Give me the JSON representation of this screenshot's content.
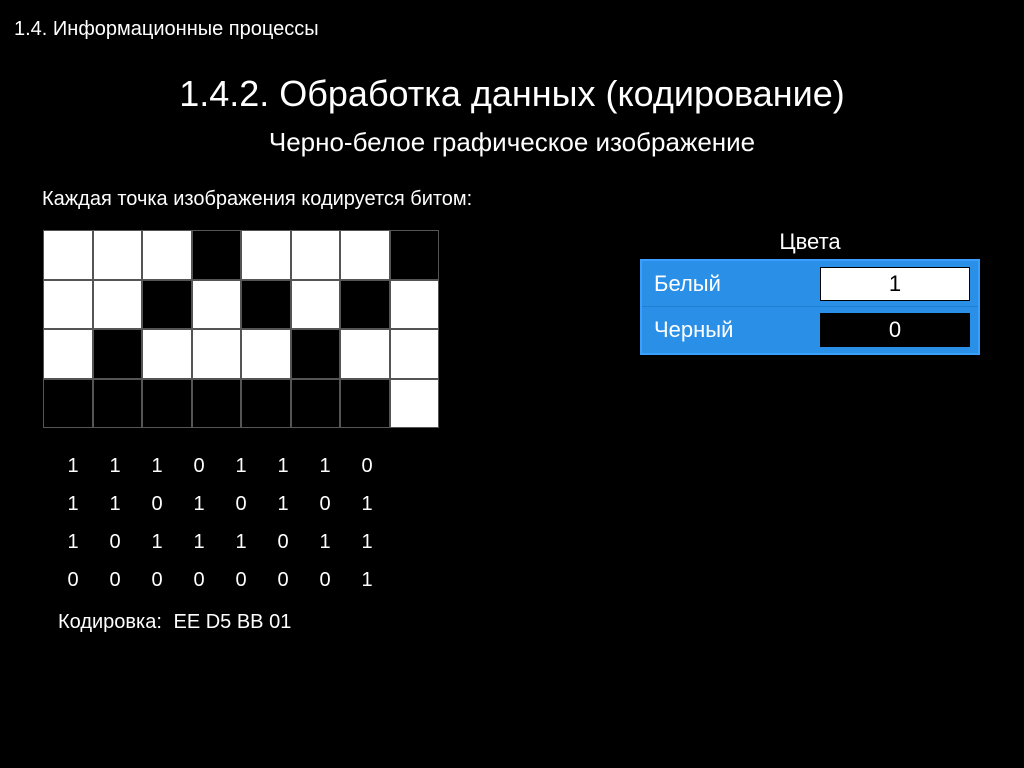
{
  "breadcrumb": "1.4. Информационные процессы",
  "title": "1.4.2. Обработка данных (кодирование)",
  "subtitle": "Черно-белое графическое изображение",
  "body_text": "Каждая точка изображения кодируется битом:",
  "pixel_grid": [
    [
      1,
      1,
      1,
      0,
      1,
      1,
      1,
      0
    ],
    [
      1,
      1,
      0,
      1,
      0,
      1,
      0,
      1
    ],
    [
      1,
      0,
      1,
      1,
      1,
      0,
      1,
      1
    ],
    [
      0,
      0,
      0,
      0,
      0,
      0,
      0,
      1
    ]
  ],
  "bit_rows": [
    [
      "1",
      "1",
      "1",
      "0",
      "1",
      "1",
      "1",
      "0"
    ],
    [
      "1",
      "1",
      "0",
      "1",
      "0",
      "1",
      "0",
      "1"
    ],
    [
      "1",
      "0",
      "1",
      "1",
      "1",
      "0",
      "1",
      "1"
    ],
    [
      "0",
      "0",
      "0",
      "0",
      "0",
      "0",
      "0",
      "1"
    ]
  ],
  "encoding_label": "Кодировка:",
  "encoding_value": "EE D5 BB 01",
  "legend": {
    "title": "Цвета",
    "rows": [
      {
        "label": "Белый",
        "value": "1",
        "box": "white"
      },
      {
        "label": "Черный",
        "value": "0",
        "box": "black"
      }
    ]
  }
}
